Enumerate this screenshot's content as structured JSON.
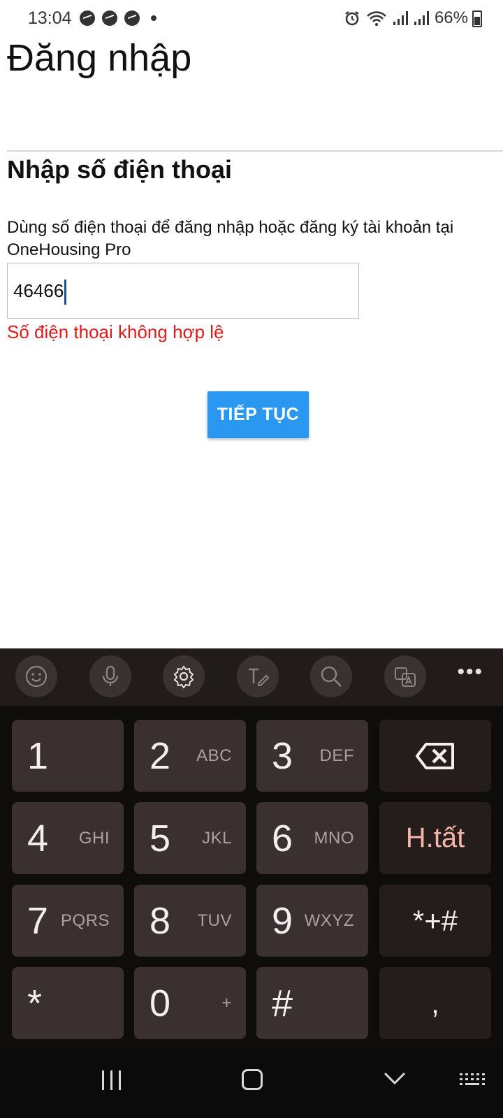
{
  "status_bar": {
    "time": "13:04",
    "battery": "66%",
    "icons_left": [
      "messenger-icon",
      "messenger-icon",
      "messenger-icon",
      "dot-icon"
    ],
    "icons_right": [
      "alarm-icon",
      "wifi-icon",
      "signal-icon",
      "signal-icon",
      "battery-icon"
    ]
  },
  "page": {
    "title": "Đăng nhập",
    "section_title": "Nhập số điện thoại",
    "description": "Dùng số điện thoại để đăng nhập hoặc đăng ký tài khoản tại OneHousing Pro",
    "phone_value": "46466",
    "error": "Số điện thoại không hợp lệ",
    "continue_label": "TIẾP TỤC"
  },
  "keyboard": {
    "toolbar": [
      "emoji-icon",
      "mic-icon",
      "settings-icon",
      "handwriting-icon",
      "search-icon",
      "translate-icon",
      "more-icon"
    ],
    "more_label": "•••",
    "keys": [
      {
        "num": "1",
        "letters": ""
      },
      {
        "num": "2",
        "letters": "ABC"
      },
      {
        "num": "3",
        "letters": "DEF"
      },
      {
        "num": "4",
        "letters": "GHI"
      },
      {
        "num": "5",
        "letters": "JKL"
      },
      {
        "num": "6",
        "letters": "MNO"
      },
      {
        "num": "7",
        "letters": "PQRS"
      },
      {
        "num": "8",
        "letters": "TUV"
      },
      {
        "num": "9",
        "letters": "WXYZ"
      },
      {
        "num": "*",
        "letters": ""
      },
      {
        "num": "0",
        "letters": "+"
      },
      {
        "num": "#",
        "letters": ""
      }
    ],
    "side_keys": {
      "backspace": "backspace-icon",
      "done": "H.tất",
      "symbols": "*+#",
      "comma": ","
    }
  },
  "navbar": {
    "items": [
      "recent-apps-icon",
      "home-icon",
      "back-icon",
      "keyboard-icon"
    ]
  },
  "colors": {
    "accent": "#2a98f0",
    "error": "#e01b1b",
    "keyboard_bg": "#0f0c0c",
    "key_bg": "#3a3030",
    "done_text": "#f3b5a8"
  }
}
